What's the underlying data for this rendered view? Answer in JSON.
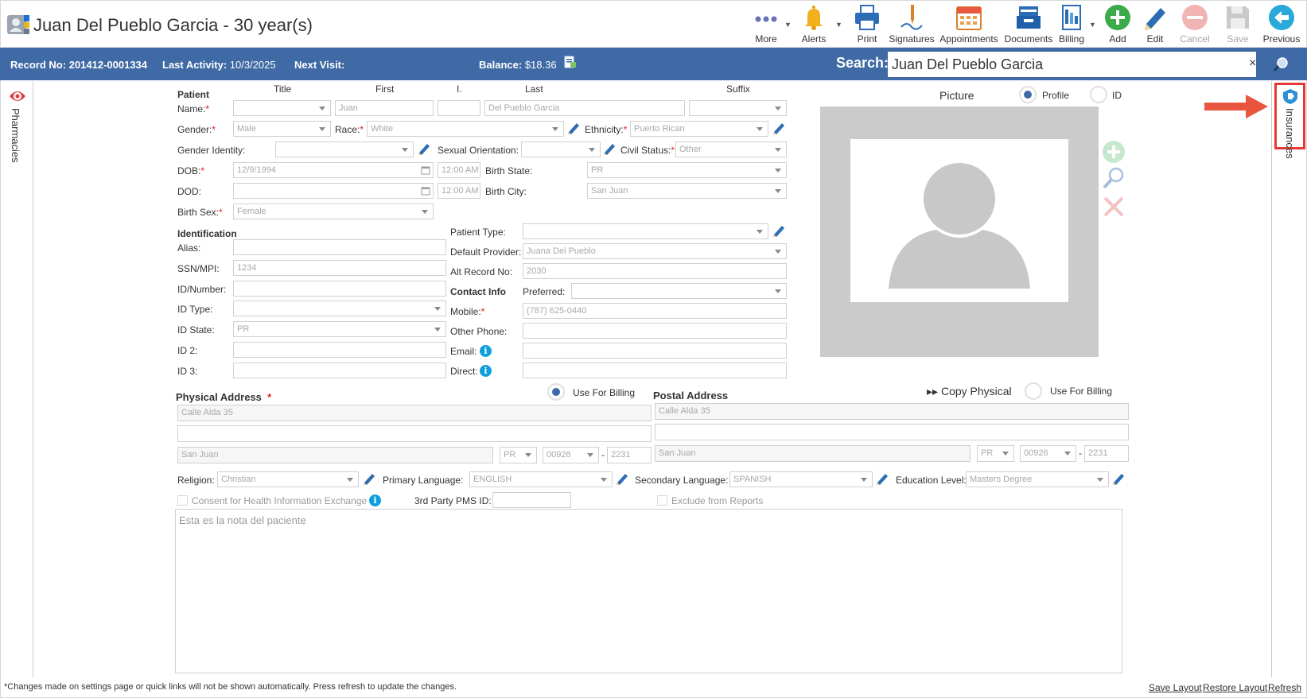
{
  "window": {
    "title": "Juan Del Pueblo Garcia - 30 year(s)"
  },
  "toolbar": {
    "more": "More",
    "alerts": "Alerts",
    "print": "Print",
    "signatures": "Signatures",
    "appointments": "Appointments",
    "documents": "Documents",
    "billing": "Billing",
    "add": "Add",
    "edit": "Edit",
    "cancel": "Cancel",
    "save": "Save",
    "previous": "Previous"
  },
  "infobar": {
    "record_label": "Record No:",
    "record_value": "201412-0001334",
    "activity_label": "Last Activity:",
    "activity_value": "10/3/2025",
    "next_visit_label": "Next Visit:",
    "balance_label": "Balance:",
    "balance_value": "$18.36",
    "search_label": "Search:",
    "search_value": "Juan Del Pueblo Garcia",
    "search_clear": "×"
  },
  "side": {
    "left_tab": "Pharmacies",
    "right_tab": "Insurances"
  },
  "patient": {
    "section": "Patient",
    "col_title": "Title",
    "col_first": "First",
    "col_initial": "I.",
    "col_last": "Last",
    "col_suffix": "Suffix",
    "name_label": "Name:",
    "first_name": "Juan",
    "last_name": "Del Pueblo Garcia",
    "gender_label": "Gender:",
    "gender": "Male",
    "race_label": "Race:",
    "race": "White",
    "ethnicity_label": "Ethnicity:",
    "ethnicity": "Puerto Rican",
    "gender_identity_label": "Gender Identity:",
    "sexual_orientation_label": "Sexual Orientation:",
    "civil_status_label": "Civil Status:",
    "civil_status": "Other",
    "dob_label": "DOB:",
    "dob": "12/9/1994",
    "dob_time": "12:00 AM",
    "birth_state_label": "Birth State:",
    "birth_state": "PR",
    "dod_label": "DOD:",
    "dod_time": "12:00 AM",
    "birth_city_label": "Birth City:",
    "birth_city": "San Juan",
    "birth_sex_label": "Birth Sex:",
    "birth_sex": "Female"
  },
  "identification": {
    "section": "Identification",
    "alias_label": "Alias:",
    "ssn_label": "SSN/MPI:",
    "ssn": "1234",
    "id_number_label": "ID/Number:",
    "id_type_label": "ID Type:",
    "id_state_label": "ID State:",
    "id_state": "PR",
    "id2_label": "ID 2:",
    "id3_label": "ID 3:"
  },
  "misc": {
    "patient_type_label": "Patient Type:",
    "default_provider_label": "Default Provider:",
    "default_provider": "Juana Del Pueblo",
    "alt_record_label": "Alt Record No:",
    "alt_record": "2030"
  },
  "contact": {
    "section": "Contact Info",
    "preferred_label": "Preferred:",
    "mobile_label": "Mobile:",
    "mobile": "(787) 625-0440",
    "other_phone_label": "Other Phone:",
    "email_label": "Email:",
    "direct_label": "Direct:"
  },
  "picture": {
    "label": "Picture",
    "profile_label": "Profile",
    "id_label": "ID"
  },
  "physical": {
    "title": "Physical Address",
    "use_billing": "Use For Billing",
    "line1": "Calle Alda 35",
    "line2": "",
    "city": "San Juan",
    "state": "PR",
    "zip": "00926",
    "zip4": "2231"
  },
  "postal": {
    "title": "Postal Address",
    "copy": "Copy Physical",
    "use_billing": "Use For Billing",
    "line1": "Calle Alda 35",
    "line2": "",
    "city": "San Juan",
    "state": "PR",
    "zip": "00926",
    "zip4": "2231"
  },
  "extra": {
    "religion_label": "Religion:",
    "religion": "Christian",
    "primary_language_label": "Primary Language:",
    "primary_language": "ENGLISH",
    "secondary_language_label": "Secondary Language:",
    "secondary_language": "SPANISH",
    "education_label": "Education Level:",
    "education": "Masters Degree",
    "consent_label": "Consent for Health Information Exchange",
    "pms_label": "3rd Party PMS ID:",
    "exclude_label": "Exclude from Reports",
    "notes": "Esta es la nota del paciente"
  },
  "footer": {
    "note": "*Changes made on settings page or quick links will not be shown automatically. Press refresh to update the changes.",
    "save_layout": "Save Layout",
    "restore_layout": "Restore Layout",
    "refresh": "Refresh"
  },
  "colors": {
    "header_blue": "#3f6aa5",
    "required_red": "#e02020",
    "highlight_red": "#e53935"
  }
}
